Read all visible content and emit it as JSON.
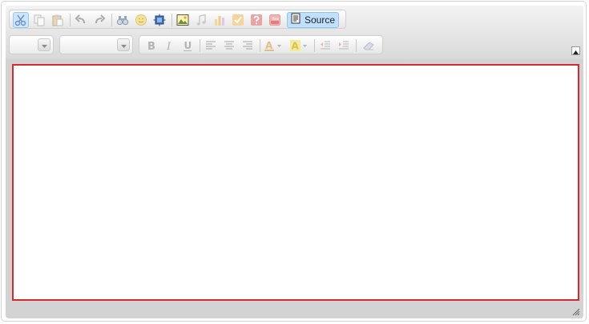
{
  "toolbar": {
    "row1": {
      "cut": "scissors-icon",
      "copy": "copy-icon",
      "paste": "paste-icon",
      "undo": "undo-icon",
      "redo": "redo-icon",
      "find": "binoculars-icon",
      "smiley": "smiley-icon",
      "block": "show-blocks-icon",
      "image": "image-icon",
      "media": "music-note-icon",
      "chart": "bar-chart-icon",
      "check": "checkmark-icon",
      "help": "question-icon",
      "video": "youtube-icon",
      "source_label": "Source"
    },
    "row2": {
      "font_value": "",
      "size_value": ""
    }
  },
  "colors": {
    "accent_border": "#d9272e",
    "active_button_bg": "#bfe0ff",
    "toolbar_bg": "#e4e4e4"
  },
  "content": {
    "text": ""
  }
}
